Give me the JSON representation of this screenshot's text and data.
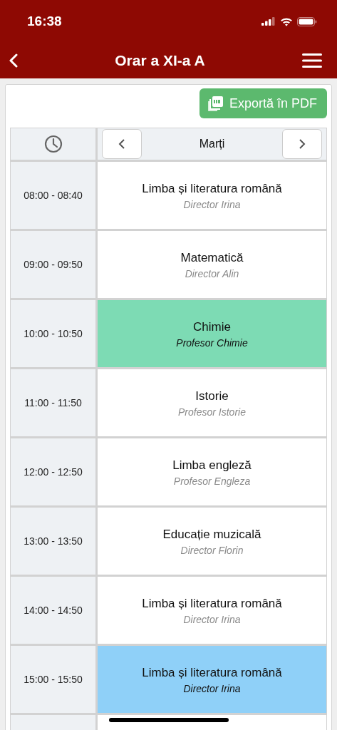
{
  "status_bar": {
    "time": "16:38"
  },
  "nav_bar": {
    "title": "Orar a XI-a A"
  },
  "export_button": {
    "label": "Exportă în PDF"
  },
  "day_header": {
    "day": "Marți"
  },
  "rows": [
    {
      "time": "08:00 - 08:40",
      "subject": "Limba și literatura română",
      "teacher": "Director Irina",
      "color": "#ffffff"
    },
    {
      "time": "09:00 - 09:50",
      "subject": "Matematică",
      "teacher": "Director Alin",
      "color": "#ffffff"
    },
    {
      "time": "10:00 - 10:50",
      "subject": "Chimie",
      "teacher": "Profesor Chimie",
      "color": "#7ddbb4"
    },
    {
      "time": "11:00 - 11:50",
      "subject": "Istorie",
      "teacher": "Profesor Istorie",
      "color": "#ffffff"
    },
    {
      "time": "12:00 - 12:50",
      "subject": "Limba engleză",
      "teacher": "Profesor Engleza",
      "color": "#ffffff"
    },
    {
      "time": "13:00 - 13:50",
      "subject": "Educație muzicală",
      "teacher": "Director Florin",
      "color": "#ffffff"
    },
    {
      "time": "14:00 - 14:50",
      "subject": "Limba și literatura română",
      "teacher": "Director Irina",
      "color": "#ffffff"
    },
    {
      "time": "15:00 - 15:50",
      "subject": "Limba și literatura română",
      "teacher": "Director Irina",
      "color": "#8fd0f8"
    }
  ]
}
